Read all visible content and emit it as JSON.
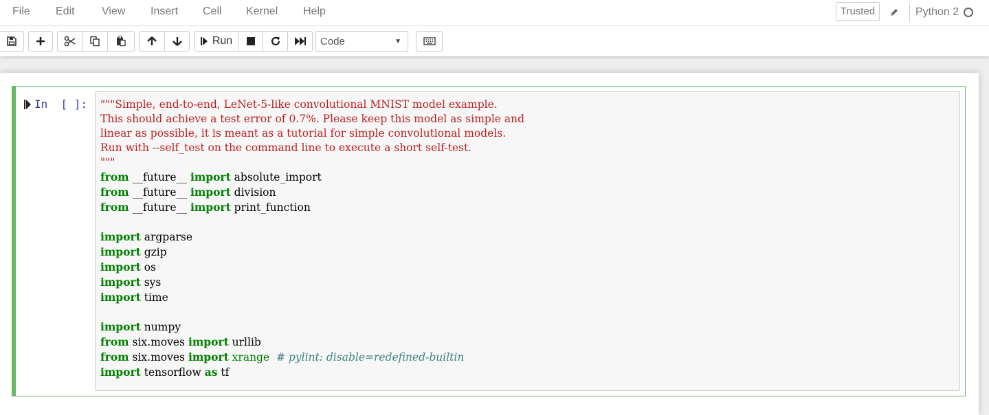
{
  "menubar": {
    "items": [
      "File",
      "Edit",
      "View",
      "Insert",
      "Cell",
      "Kernel",
      "Help"
    ],
    "trusted": "Trusted",
    "kernel_name": "Python 2"
  },
  "toolbar": {
    "run_label": "Run",
    "cell_type": "Code",
    "icons": [
      "save-icon",
      "plus-icon",
      "scissors-icon",
      "copy-icon",
      "paste-icon",
      "arrow-up-icon",
      "arrow-down-icon",
      "step-forward-icon",
      "stop-icon",
      "restart-icon",
      "fast-forward-icon",
      "keyboard-icon"
    ]
  },
  "cell": {
    "prompt": "In  [ ]:",
    "accent_color": "#66bb6a",
    "code_lines": [
      [
        {
          "t": "\"\"\"Simple, end-to-end, LeNet-5-like convolutional MNIST model example.",
          "c": "str"
        }
      ],
      [
        {
          "t": "This should achieve a test error of 0.7%. Please keep this model as simple and",
          "c": "str"
        }
      ],
      [
        {
          "t": "linear as possible, it is meant as a tutorial for simple convolutional models.",
          "c": "str"
        }
      ],
      [
        {
          "t": "Run with --self_test on the command line to execute a short self-test.",
          "c": "str"
        }
      ],
      [
        {
          "t": "\"\"\"",
          "c": "str"
        }
      ],
      [
        {
          "t": "from",
          "c": "kw"
        },
        {
          "t": " __future__ ",
          "c": ""
        },
        {
          "t": "import",
          "c": "kw"
        },
        {
          "t": " absolute_import",
          "c": ""
        }
      ],
      [
        {
          "t": "from",
          "c": "kw"
        },
        {
          "t": " __future__ ",
          "c": ""
        },
        {
          "t": "import",
          "c": "kw"
        },
        {
          "t": " division",
          "c": ""
        }
      ],
      [
        {
          "t": "from",
          "c": "kw"
        },
        {
          "t": " __future__ ",
          "c": ""
        },
        {
          "t": "import",
          "c": "kw"
        },
        {
          "t": " print_function",
          "c": ""
        }
      ],
      [],
      [
        {
          "t": "import",
          "c": "kw"
        },
        {
          "t": " argparse",
          "c": ""
        }
      ],
      [
        {
          "t": "import",
          "c": "kw"
        },
        {
          "t": " gzip",
          "c": ""
        }
      ],
      [
        {
          "t": "import",
          "c": "kw"
        },
        {
          "t": " os",
          "c": ""
        }
      ],
      [
        {
          "t": "import",
          "c": "kw"
        },
        {
          "t": " sys",
          "c": ""
        }
      ],
      [
        {
          "t": "import",
          "c": "kw"
        },
        {
          "t": " time",
          "c": ""
        }
      ],
      [],
      [
        {
          "t": "import",
          "c": "kw"
        },
        {
          "t": " numpy",
          "c": ""
        }
      ],
      [
        {
          "t": "from",
          "c": "kw"
        },
        {
          "t": " six.moves ",
          "c": ""
        },
        {
          "t": "import",
          "c": "kw"
        },
        {
          "t": " urllib",
          "c": ""
        }
      ],
      [
        {
          "t": "from",
          "c": "kw"
        },
        {
          "t": " six.moves ",
          "c": ""
        },
        {
          "t": "import",
          "c": "kw"
        },
        {
          "t": " ",
          "c": ""
        },
        {
          "t": "xrange",
          "c": "bi"
        },
        {
          "t": "  ",
          "c": ""
        },
        {
          "t": "# pylint: disable=redefined-builtin",
          "c": "cm"
        }
      ],
      [
        {
          "t": "import",
          "c": "kw"
        },
        {
          "t": " tensorflow ",
          "c": ""
        },
        {
          "t": "as",
          "c": "kw"
        },
        {
          "t": " tf",
          "c": ""
        }
      ]
    ]
  }
}
